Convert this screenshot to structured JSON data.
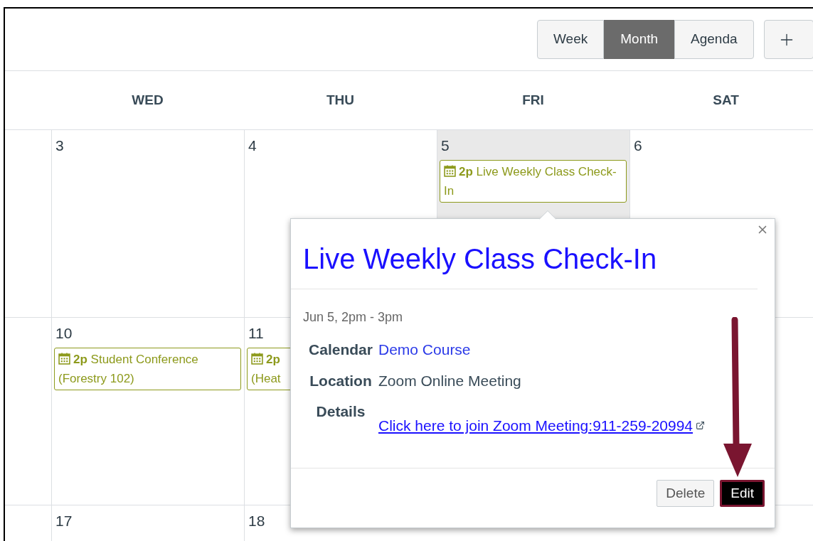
{
  "view_buttons": [
    {
      "label": "Week",
      "selected": false
    },
    {
      "label": "Month",
      "selected": true
    },
    {
      "label": "Agenda",
      "selected": false
    }
  ],
  "weekdays": [
    "WED",
    "THU",
    "FRI",
    "SAT"
  ],
  "weeks": [
    {
      "days": [
        {
          "date": "3",
          "highlighted": false
        },
        {
          "date": "4",
          "highlighted": false
        },
        {
          "date": "5",
          "highlighted": true,
          "events": [
            {
              "time": "2p",
              "title": "Live Weekly Class Check-In",
              "kind": "full"
            }
          ]
        },
        {
          "date": "6",
          "highlighted": false
        }
      ]
    },
    {
      "days": [
        {
          "date": "10",
          "highlighted": false,
          "events": [
            {
              "time": "2p",
              "title": "Student Conference (Forestry 102)",
              "kind": "full"
            }
          ]
        },
        {
          "date": "11",
          "highlighted": false,
          "events": [
            {
              "time": "2p",
              "title": "(Heat",
              "kind": "clipped"
            }
          ]
        }
      ]
    },
    {
      "days": [
        {
          "date": "17",
          "highlighted": false
        },
        {
          "date": "18",
          "highlighted": false
        }
      ]
    }
  ],
  "popover": {
    "title": "Live Weekly Class Check-In",
    "when": "Jun 5, 2pm - 3pm",
    "fields": [
      {
        "label": "Calendar",
        "value": "Demo Course",
        "kind": "link"
      },
      {
        "label": "Location",
        "value": "Zoom Online Meeting",
        "kind": "text"
      },
      {
        "label": "Details",
        "value": "Click here to join Zoom Meeting:911-259-20994",
        "kind": "external"
      }
    ],
    "buttons": [
      {
        "label": "Delete",
        "kind": "secondary"
      },
      {
        "label": "Edit",
        "kind": "primary"
      }
    ]
  }
}
